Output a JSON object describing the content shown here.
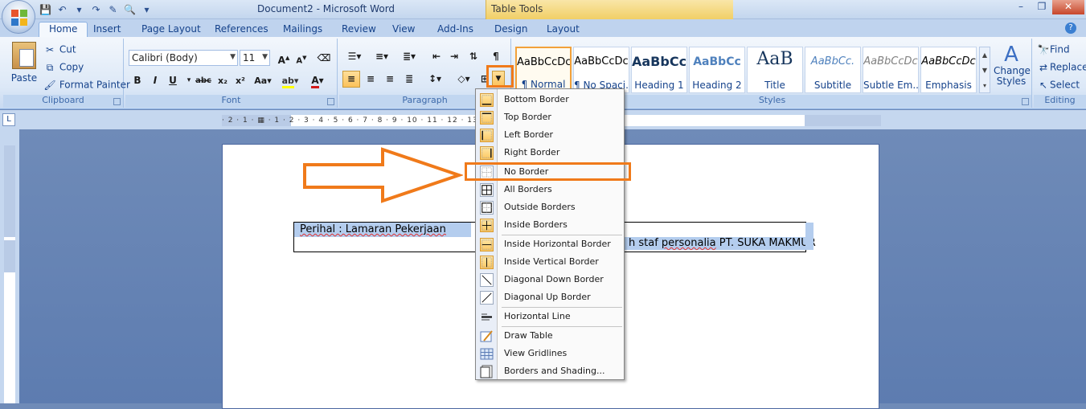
{
  "window": {
    "title": "Document2 - Microsoft Word",
    "context_tab_group": "Table Tools"
  },
  "tabs": [
    {
      "label": "Home"
    },
    {
      "label": "Insert"
    },
    {
      "label": "Page Layout"
    },
    {
      "label": "References"
    },
    {
      "label": "Mailings"
    },
    {
      "label": "Review"
    },
    {
      "label": "View"
    },
    {
      "label": "Add-Ins"
    },
    {
      "label": "Design"
    },
    {
      "label": "Layout"
    }
  ],
  "clipboard": {
    "label": "Clipboard",
    "paste": "Paste",
    "cut": "Cut",
    "copy": "Copy",
    "format_painter": "Format Painter"
  },
  "font": {
    "label": "Font",
    "family": "Calibri (Body)",
    "size": "11"
  },
  "paragraph": {
    "label": "Paragraph"
  },
  "styles": {
    "label": "Styles",
    "items": [
      {
        "preview": "AaBbCcDc",
        "name": "¶ Normal"
      },
      {
        "preview": "AaBbCcDc",
        "name": "¶ No Spaci..."
      },
      {
        "preview": "AaBbCc",
        "name": "Heading 1"
      },
      {
        "preview": "AaBbCc",
        "name": "Heading 2"
      },
      {
        "preview": "AaB",
        "name": "Title"
      },
      {
        "preview": "AaBbCc.",
        "name": "Subtitle"
      },
      {
        "preview": "AaBbCcDc",
        "name": "Subtle Em..."
      },
      {
        "preview": "AaBbCcDc",
        "name": "Emphasis"
      }
    ],
    "change_styles": "Change Styles"
  },
  "editing": {
    "label": "Editing",
    "find": "Find",
    "replace": "Replace",
    "select": "Select"
  },
  "ruler": {
    "h_marks": "· 2 · 1 · ▦ · 1 · 2 · 3 · 4 · 5 · 6 · 7 · 8 · 9 · 10 · 11 · 12 · 13 · 14 · 15 · 16 · ▦ 17 · 18 · 19"
  },
  "document": {
    "cell1": "Perihal : Lamaran Pekerjaan",
    "cell2_prefix": "h staf ",
    "cell2_underlined": "personalia",
    "cell2_suffix": " PT. SUKA MAKMUR"
  },
  "border_menu": {
    "items": [
      {
        "label": "Bottom Border"
      },
      {
        "label": "Top Border"
      },
      {
        "label": "Left Border"
      },
      {
        "label": "Right Border"
      },
      {
        "label": "No Border"
      },
      {
        "label": "All Borders"
      },
      {
        "label": "Outside Borders"
      },
      {
        "label": "Inside Borders"
      },
      {
        "label": "Inside Horizontal Border"
      },
      {
        "label": "Inside Vertical Border"
      },
      {
        "label": "Diagonal Down Border"
      },
      {
        "label": "Diagonal Up Border"
      },
      {
        "label": "Horizontal Line"
      },
      {
        "label": "Draw Table"
      },
      {
        "label": "View Gridlines"
      },
      {
        "label": "Borders and Shading..."
      }
    ]
  },
  "colors": {
    "accent": "#f07a1a",
    "selection": "#b4cdee",
    "ribbon": "#dce8f7"
  }
}
